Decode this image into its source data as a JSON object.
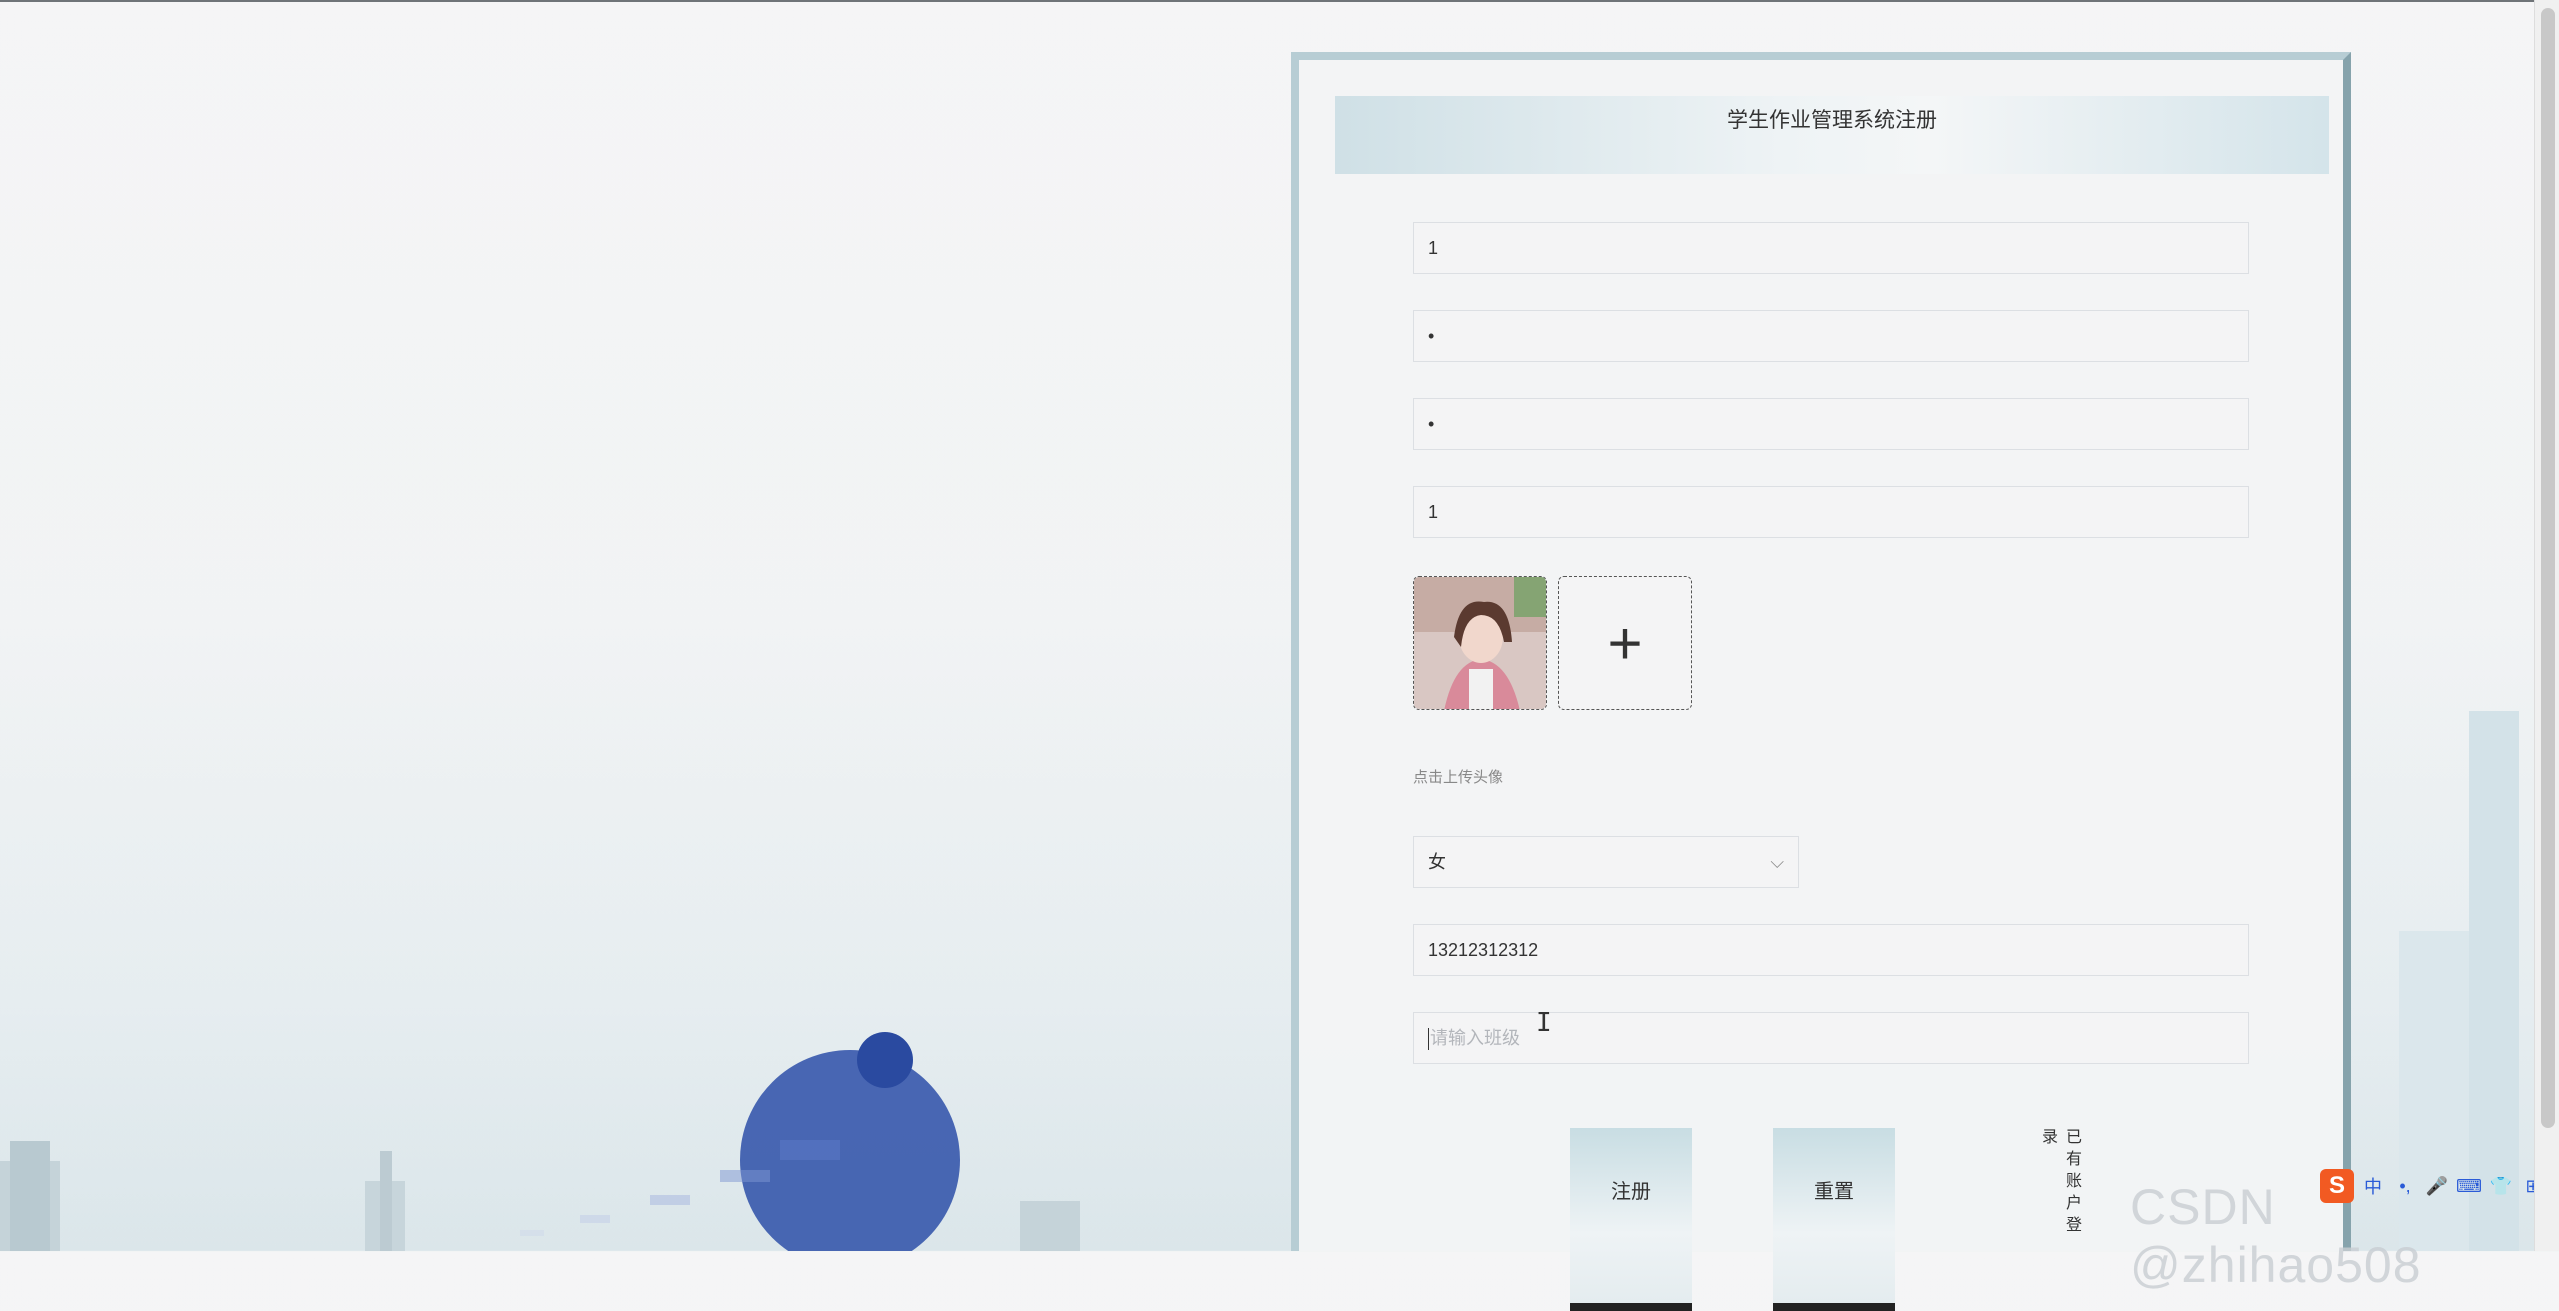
{
  "form": {
    "title": "学生作业管理系统注册",
    "fields": [
      {
        "value": "1"
      },
      {
        "value": "•"
      },
      {
        "value": "•"
      },
      {
        "value": "1"
      }
    ],
    "avatar": {
      "hint": "点击上传头像",
      "add_symbol": "+"
    },
    "gender": {
      "selected": "女"
    },
    "phone": {
      "value": "13212312312"
    },
    "class_field": {
      "placeholder": "请输入班级"
    },
    "buttons": {
      "register": "注册",
      "reset": "重置"
    },
    "login_link": "已有账户登录"
  },
  "ime": {
    "logo": "S",
    "items": [
      "中",
      "•,",
      "🎤",
      "⌨",
      "👕",
      "⊞"
    ]
  },
  "watermark": "CSDN @zhihao508",
  "colors": {
    "panel_border": "#b7cdd4",
    "button_bottom": "#222222",
    "ime_logo": "#f25a22",
    "ime_icons": "#2a5bd7"
  }
}
